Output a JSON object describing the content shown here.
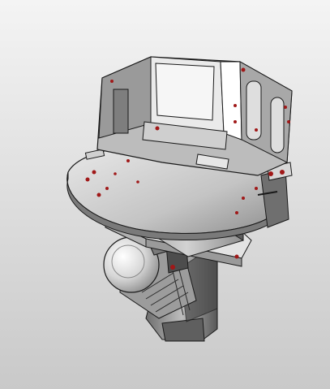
{
  "viewport": {
    "background_top": "#f4f4f4",
    "background_bottom": "#c9c9c9"
  },
  "model": {
    "body_color": "#b9b9b9",
    "light_face_color": "#e6e6e6",
    "dark_face_color": "#5a5a5a",
    "edge_color": "#1a1a1a",
    "fastener_color": "#a01818"
  }
}
